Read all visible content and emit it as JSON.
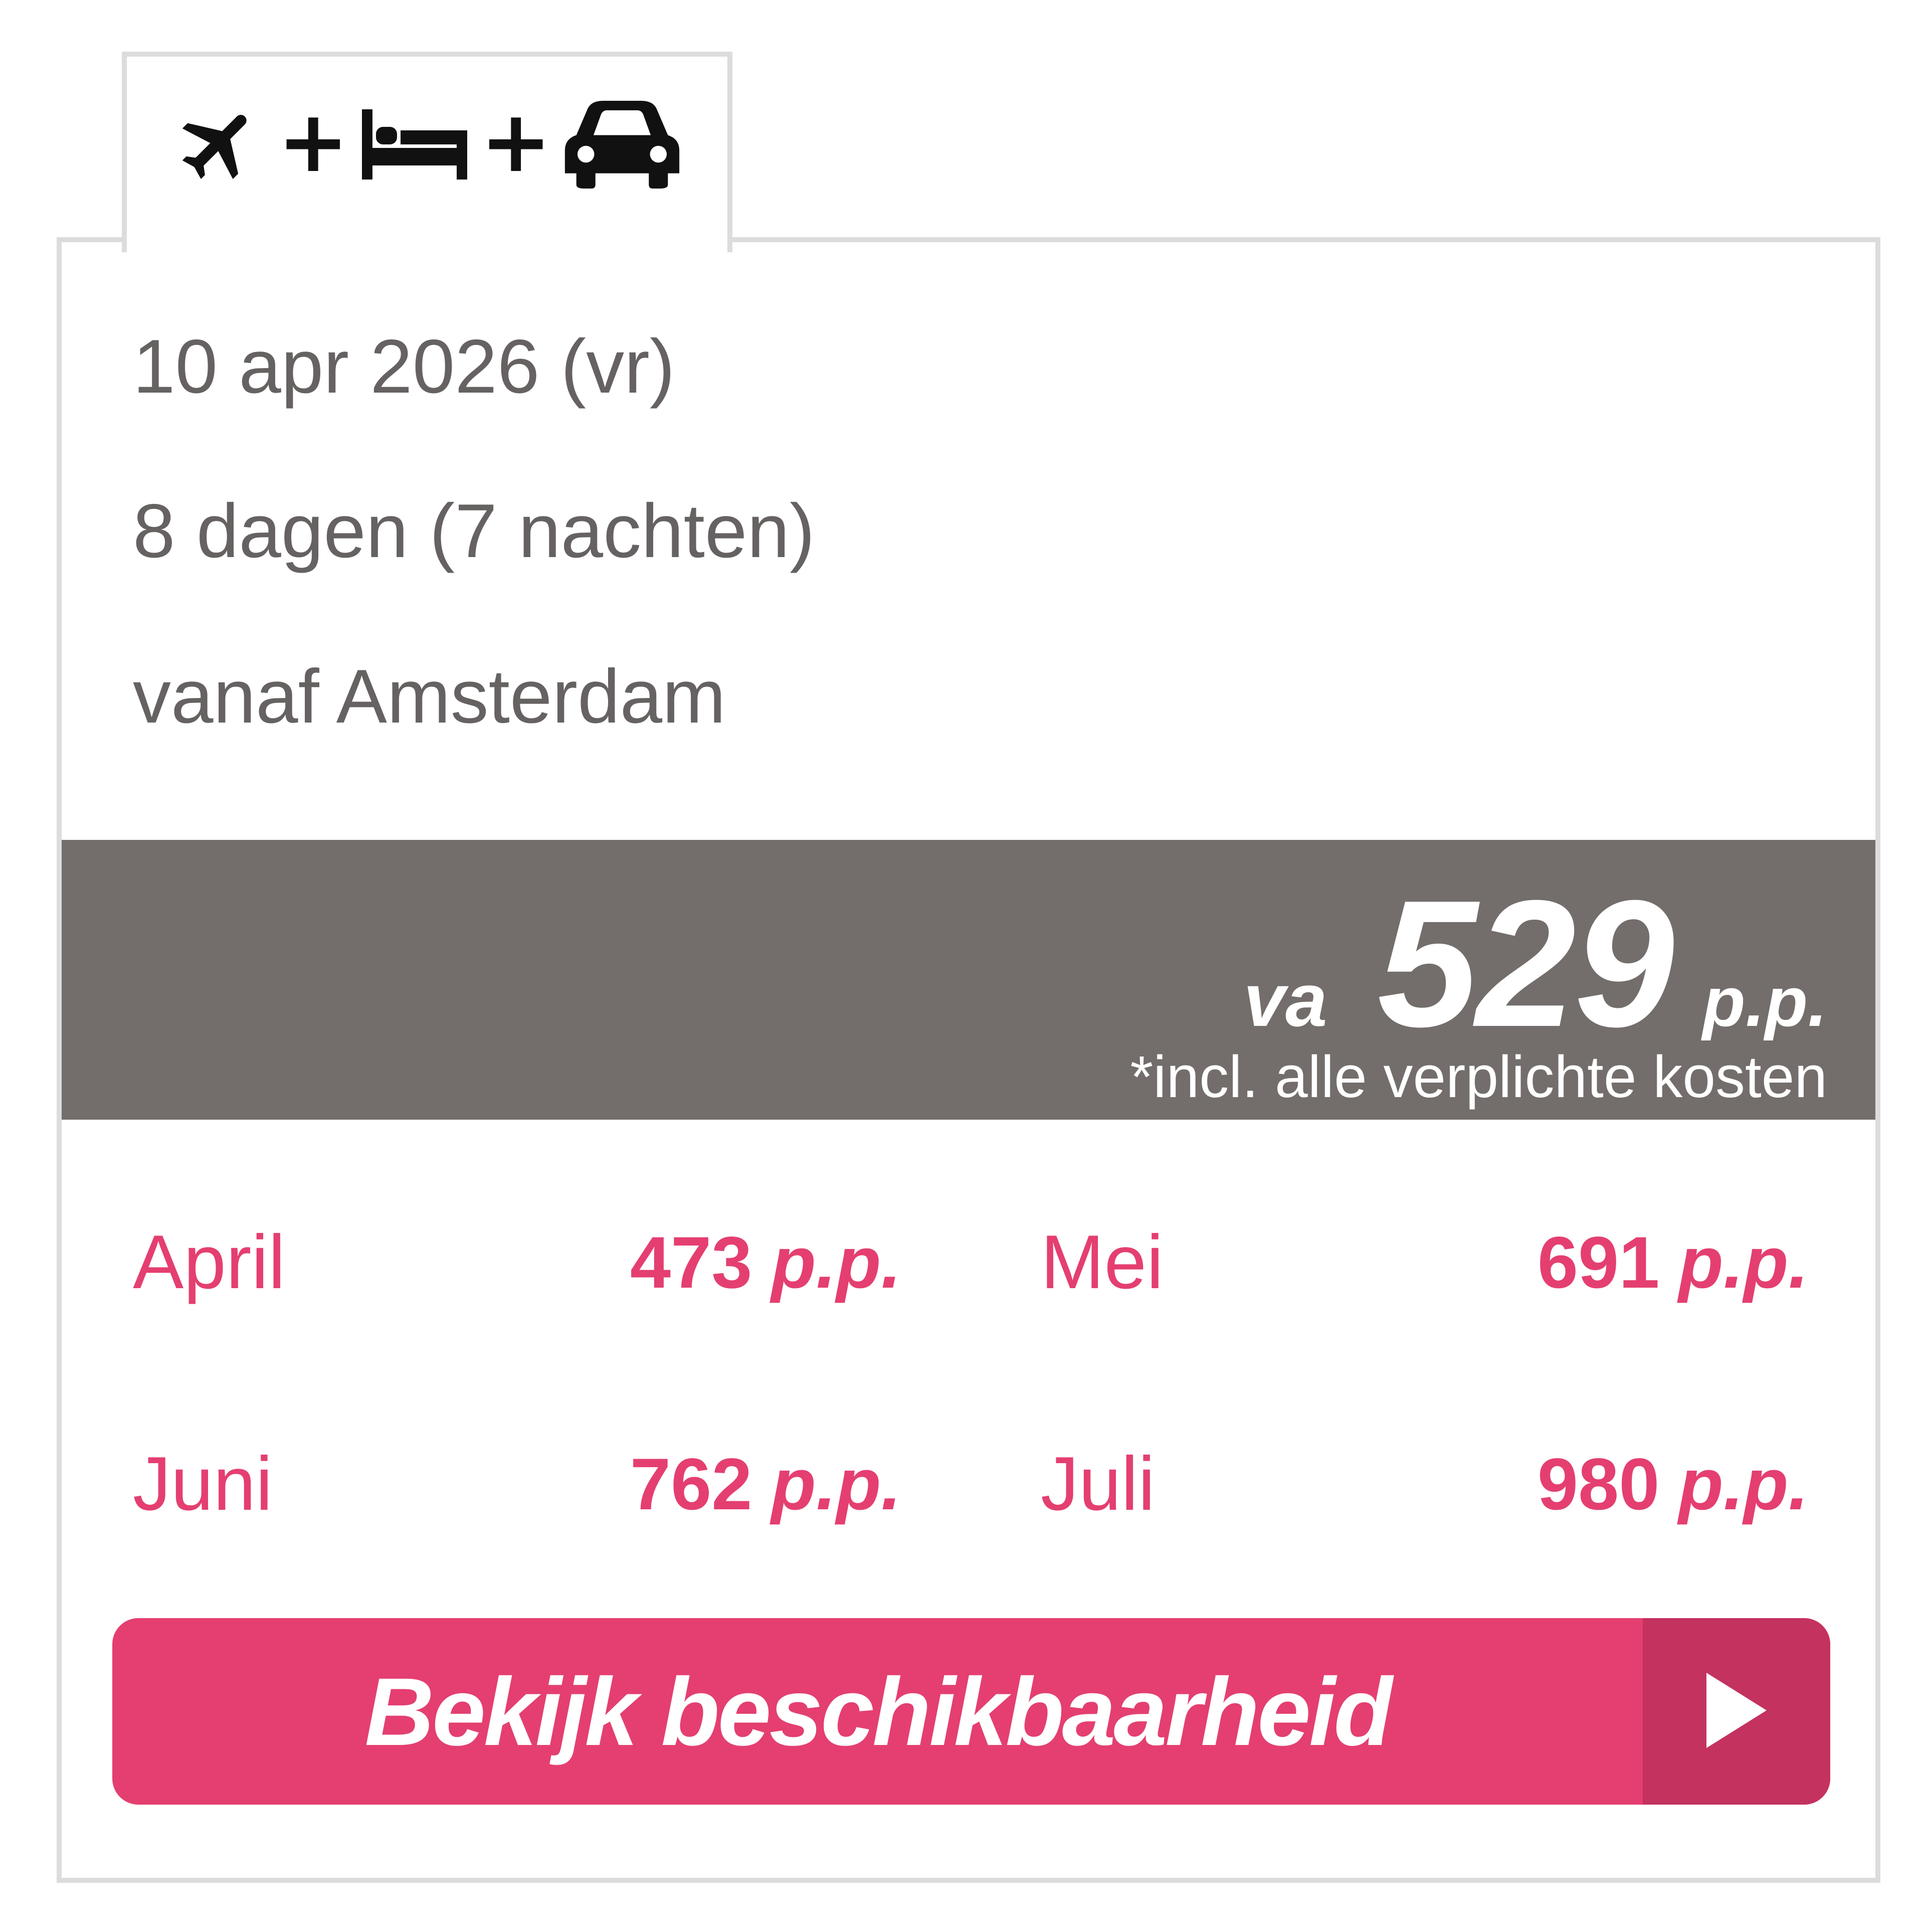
{
  "tab": {
    "icons": [
      "plane-icon",
      "bed-icon",
      "car-icon"
    ],
    "separator": "+"
  },
  "info": {
    "date": "10 apr 2026 (vr)",
    "duration": "8 dagen (7 nachten)",
    "departure": "vanaf Amsterdam"
  },
  "price": {
    "prefix": "va",
    "amount": "529",
    "unit": "p.p.",
    "note": "*incl. alle verplichte kosten"
  },
  "months": [
    {
      "name": "April",
      "price": "473",
      "unit": "p.p."
    },
    {
      "name": "Mei",
      "price": "691",
      "unit": "p.p."
    },
    {
      "name": "Juni",
      "price": "762",
      "unit": "p.p."
    },
    {
      "name": "Juli",
      "price": "980",
      "unit": "p.p."
    }
  ],
  "cta": {
    "label": "Bekijk beschikbaarheid",
    "icon": "play-arrow-icon"
  },
  "colors": {
    "accent": "#e43f70",
    "accent_dark": "#c4325f",
    "band": "#736e6b",
    "text_muted": "#666262",
    "border": "#dcdcdc"
  }
}
